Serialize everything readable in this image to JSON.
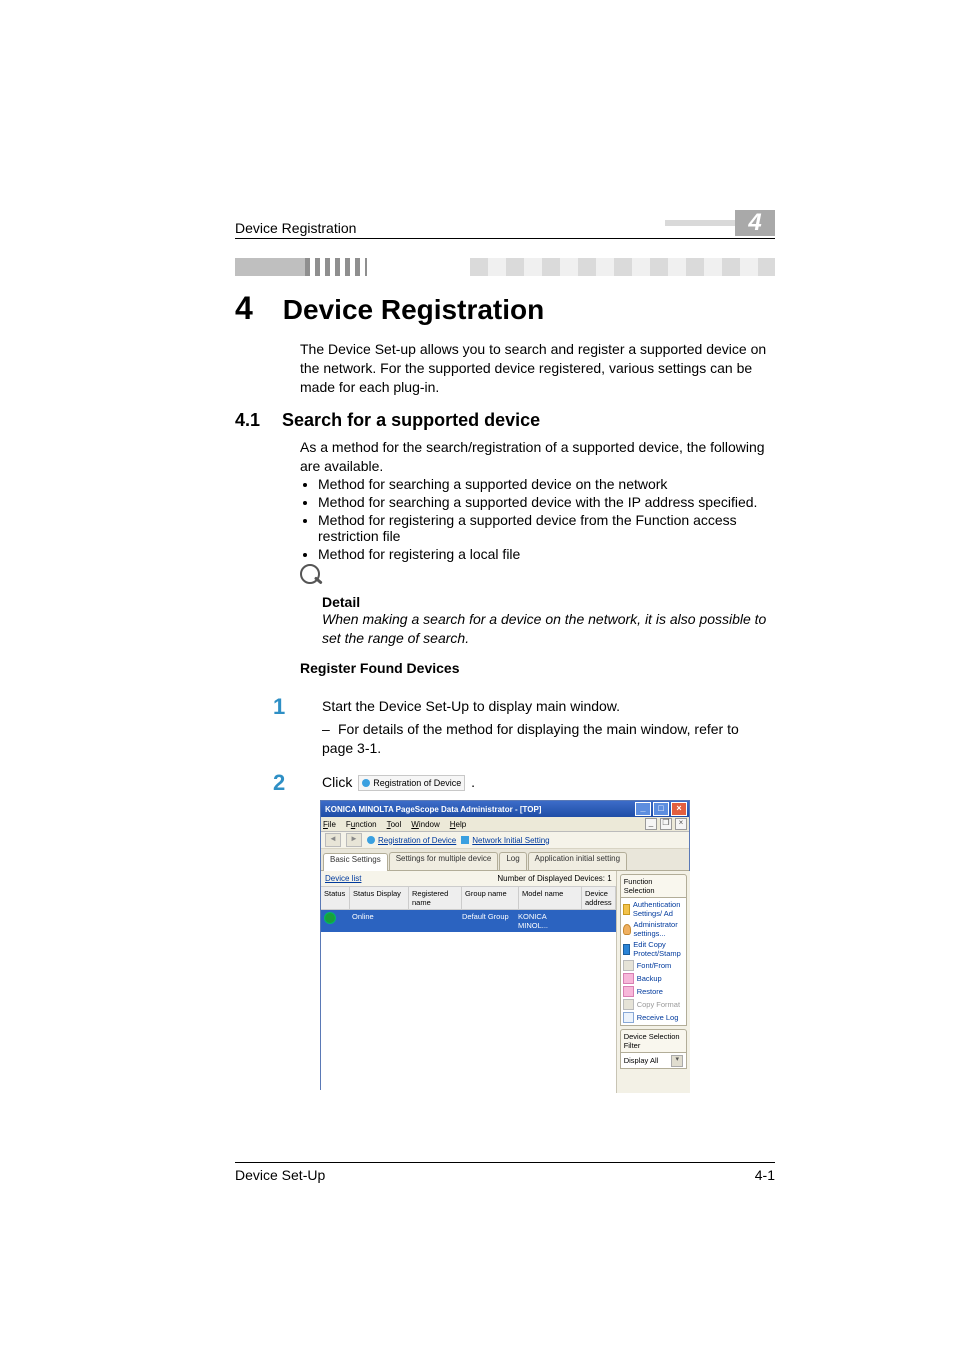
{
  "header": {
    "running_title": "Device Registration",
    "chapter_number_box": "4"
  },
  "section": {
    "chapter_number": "4",
    "chapter_title": "Device Registration",
    "intro": "The Device Set-up allows you to search and register a supported device on the network. For the supported device registered, various settings can be made for each plug-in."
  },
  "subsection": {
    "number": "4.1",
    "title": "Search for a supported device",
    "lead": "As a method for the search/registration of a supported device, the following are available.",
    "bullets": [
      "Method for searching a supported device on the network",
      "Method for searching a supported device with the IP address specified.",
      "Method for registering a supported device from the Function access restriction file",
      "Method for registering a local file"
    ]
  },
  "detail": {
    "label": "Detail",
    "note": "When making a search for a device on the network, it is also possible to set the range of search."
  },
  "procedure": {
    "heading": "Register Found Devices",
    "step1_num": "1",
    "step1": "Start the Device Set-Up to display main window.",
    "step1_sub": "For details of the method for displaying the main window, refer to page 3-1.",
    "step2_num": "2",
    "step2_pre": "Click ",
    "step2_chip": "Registration of Device",
    "step2_post": "."
  },
  "screenshot": {
    "title": "KONICA MINOLTA PageScope Data Administrator - [TOP]",
    "menu": {
      "file": "File",
      "function": "Function",
      "tool": "Tool",
      "window": "Window",
      "help": "Help"
    },
    "toolbar": {
      "back_fwd_icons": true,
      "link1": "Registration of Device",
      "link2": "Network Initial Setting"
    },
    "tabs": {
      "t1": "Basic Settings",
      "t2": "Settings for multiple device",
      "t3": "Log",
      "t4": "Application initial setting"
    },
    "device_list": {
      "label": "Device list",
      "count_label": "Number of Displayed Devices:",
      "count_value": "1",
      "columns": {
        "status": "Status",
        "status_display": "Status Display",
        "registered_name": "Registered name",
        "group_name": "Group name",
        "model_name": "Model name",
        "device_address": "Device address"
      },
      "row": {
        "status_display": "Online",
        "registered_name": "",
        "group_name": "Default Group",
        "model_name": "KONICA MINOL...",
        "device_address": ""
      }
    },
    "function_selection": {
      "panel_title": "Function Selection",
      "items": {
        "auth": "Authentication Settings/ Ad",
        "admin": "Administrator settings...",
        "copyprotect": "Edit Copy Protect/Stamp",
        "font": "Font/From",
        "backup": "Backup",
        "restore": "Restore",
        "copyformat_disabled": "Copy Format",
        "receivelog": "Receive Log"
      },
      "subpanel_title": "Device Selection Filter",
      "select_value": "Display All"
    }
  },
  "footer": {
    "left": "Device Set-Up",
    "right": "4-1"
  }
}
